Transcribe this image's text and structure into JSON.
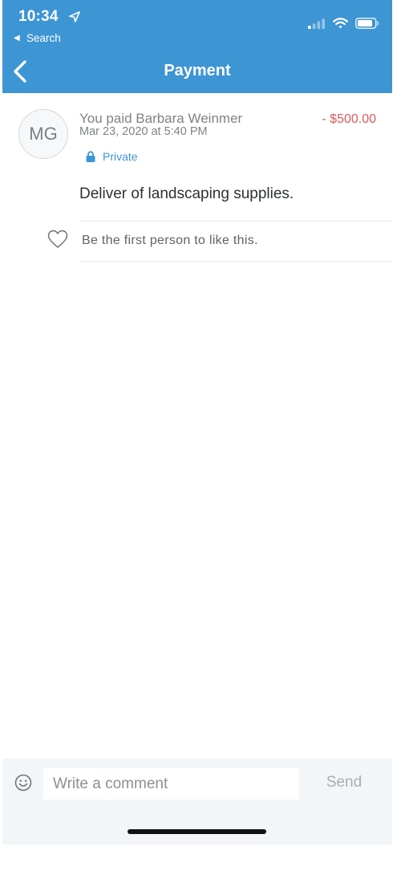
{
  "status_bar": {
    "time": "10:34",
    "back_app": "Search",
    "location_icon": "location-arrow-icon",
    "signal_icon": "cellular-signal-icon",
    "wifi_icon": "wifi-icon",
    "battery_icon": "battery-icon"
  },
  "nav": {
    "title": "Payment",
    "back_icon": "chevron-left-icon"
  },
  "payment": {
    "avatar_initials": "MG",
    "title": "You paid Barbara Weinmer",
    "amount": "- $500.00",
    "date": "Mar 23, 2020 at 5:40 PM",
    "privacy": "Private",
    "privacy_icon": "lock-icon",
    "note": "Deliver of landscaping supplies."
  },
  "likes": {
    "icon": "heart-outline-icon",
    "text": "Be the first person to like this."
  },
  "comment": {
    "emoji_icon": "smiley-icon",
    "placeholder": "Write a comment",
    "send_label": "Send"
  },
  "colors": {
    "brand_blue": "#3d95d4",
    "amount_red": "#e05a5a",
    "comment_bar_bg": "#f3f6f8"
  }
}
